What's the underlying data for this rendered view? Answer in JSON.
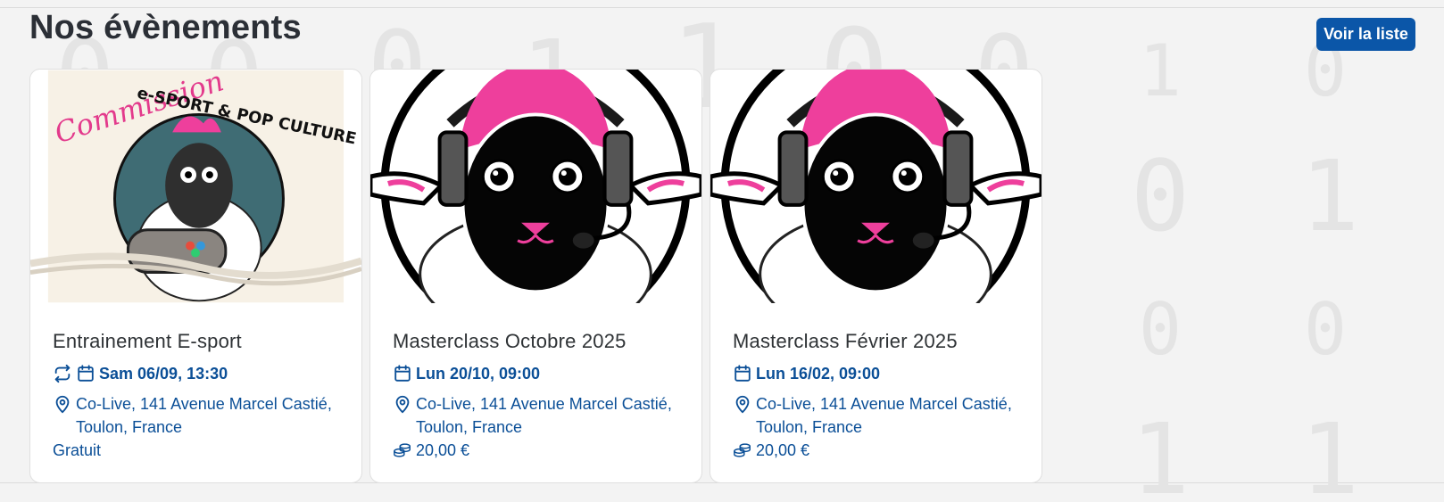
{
  "header": {
    "title": "Nos évènements",
    "list_button_label": "Voir la liste"
  },
  "background_digits": [
    "0",
    "0",
    "0",
    "1",
    "1",
    "0",
    "0",
    "1",
    "0",
    "0",
    "1",
    "0",
    "0",
    "1",
    "1"
  ],
  "colors": {
    "accent": "#0b56a8",
    "link_text": "#0b4f97",
    "page_bg": "#f3f3f3",
    "sheep_hair": "#ee3f9c"
  },
  "events": [
    {
      "title": "Entrainement E-sport",
      "recurring": true,
      "date": "Sam 06/09, 13:30",
      "location_line1": "Co-Live, 141 Avenue Marcel Castié,",
      "location_line2": "Toulon, France",
      "price": "Gratuit",
      "image_text_top": "Commission",
      "image_text_arc": "e-SPORT & POP CULTURE"
    },
    {
      "title": "Masterclass Octobre 2025",
      "recurring": false,
      "date": "Lun 20/10, 09:00",
      "location_line1": "Co-Live, 141 Avenue Marcel Castié,",
      "location_line2": "Toulon, France",
      "price": "20,00 €"
    },
    {
      "title": "Masterclass Février 2025",
      "recurring": false,
      "date": "Lun 16/02, 09:00",
      "location_line1": "Co-Live, 141 Avenue Marcel Castié,",
      "location_line2": "Toulon, France",
      "price": "20,00 €"
    }
  ]
}
